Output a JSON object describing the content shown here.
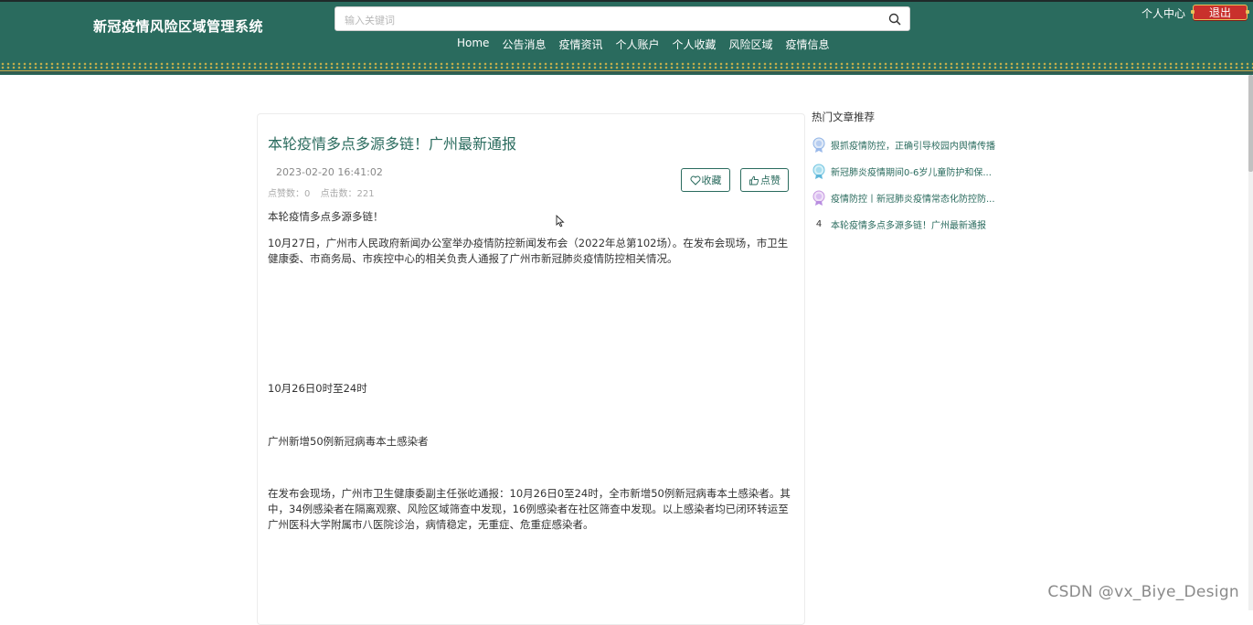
{
  "header": {
    "site_title": "新冠疫情风险区域管理系统",
    "search_placeholder": "输入关键词",
    "user_center": "个人中心",
    "logout": "退出",
    "nav": [
      "Home",
      "公告消息",
      "疫情资讯",
      "个人账户",
      "个人收藏",
      "风险区域",
      "疫情信息"
    ]
  },
  "article": {
    "title": "本轮疫情多点多源多链！广州最新通报",
    "date": "2023-02-20 16:41:02",
    "likes_label": "点赞数：0",
    "clicks_label": "点击数：221",
    "fav_button": "收藏",
    "like_button": "点赞",
    "paragraphs": [
      "本轮疫情多点多源多链！",
      "10月27日，广州市人民政府新闻办公室举办疫情防控新闻发布会（2022年总第102场）。在发布会现场，市卫生健康委、市商务局、市疾控中心的相关负责人通报了广州市新冠肺炎疫情防控相关情况。",
      "10月26日0时至24时",
      "广州新增50例新冠病毒本土感染者",
      "在发布会现场，广州市卫生健康委副主任张屹通报：10月26日0至24时，全市新增50例新冠病毒本土感染者。其中，34例感染者在隔离观察、风险区域筛查中发现，16例感染者在社区筛查中发现。以上感染者均已闭环转运至广州医科大学附属市八医院诊治，病情稳定，无重症、危重症感染者。"
    ]
  },
  "sidebar": {
    "title": "热门文章推荐",
    "items": [
      {
        "rank": "1",
        "text": "狠抓疫情防控，正确引导校园内舆情传播"
      },
      {
        "rank": "2",
        "text": "新冠肺炎疫情期间0-6岁儿童防护和保..."
      },
      {
        "rank": "3",
        "text": "疫情防控丨新冠肺炎疫情常态化防控防..."
      },
      {
        "rank": "4",
        "text": "本轮疫情多点多源多链！广州最新通报"
      }
    ]
  },
  "watermark": "CSDN @vx_Biye_Design",
  "colors": {
    "primary": "#2a6b5e",
    "logout": "#c9302c",
    "gold": "#e7c35a"
  }
}
